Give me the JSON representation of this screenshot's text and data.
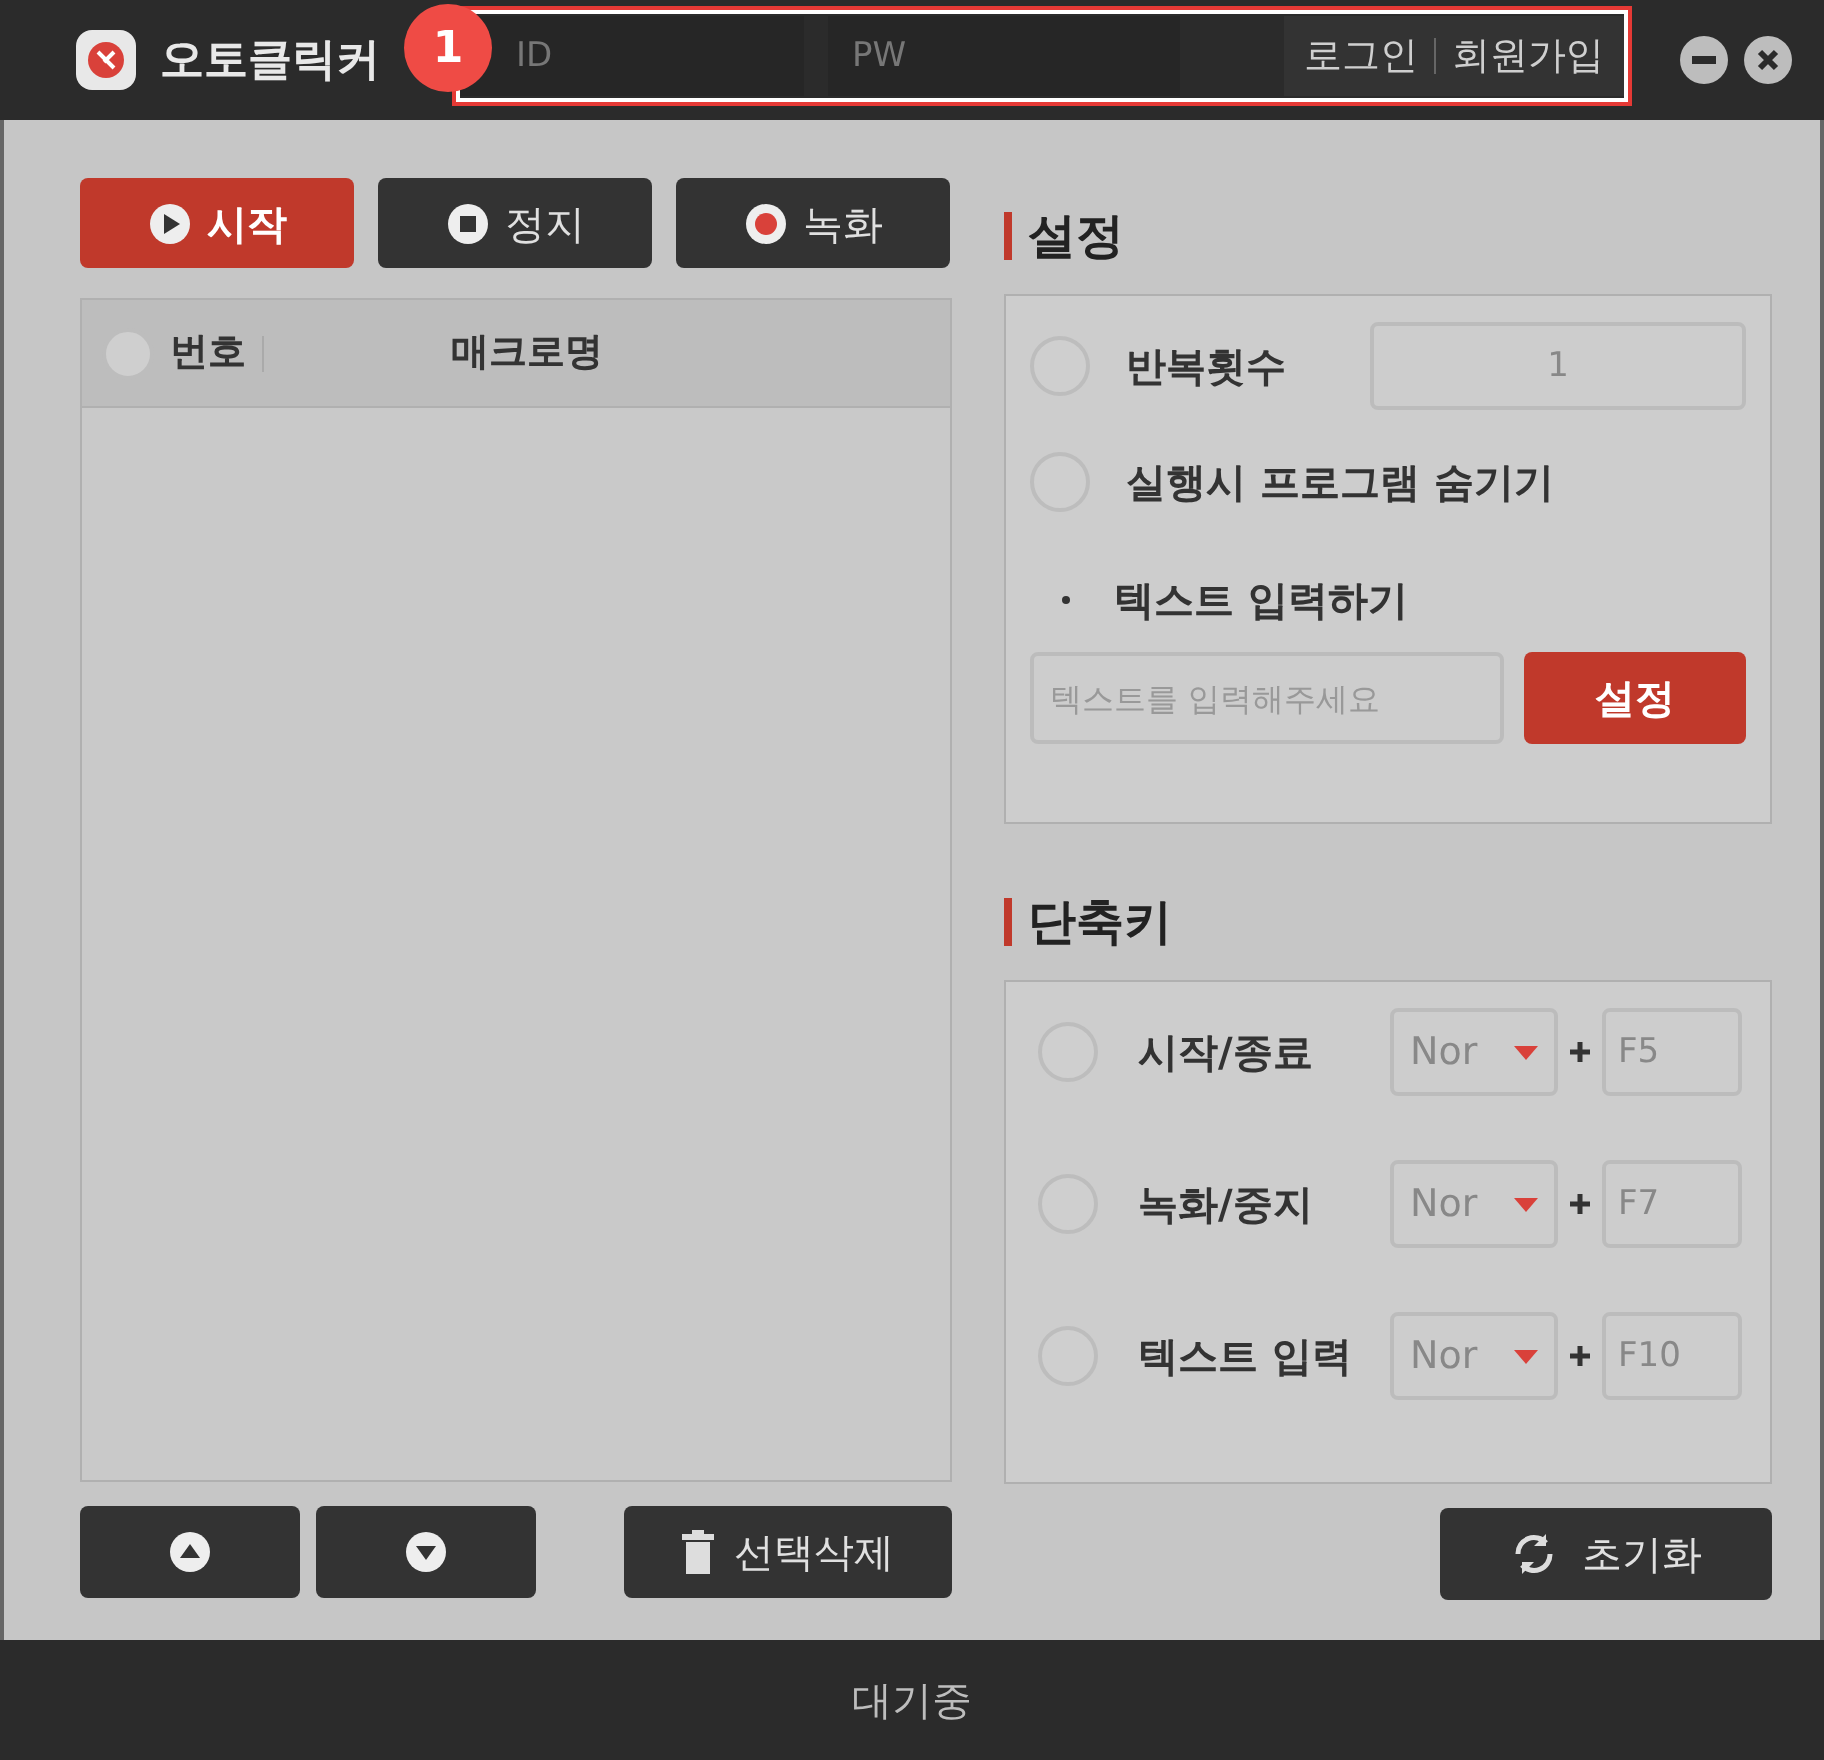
{
  "window": {
    "title": "오토클릭커"
  },
  "login": {
    "id_placeholder": "ID",
    "pw_placeholder": "PW",
    "login_button": "로그인",
    "signup_button": "회원가입",
    "annotation": "1"
  },
  "controls": [
    {
      "label": "시작",
      "kind": "play",
      "selected": true
    },
    {
      "label": "정지",
      "kind": "stop",
      "selected": false
    },
    {
      "label": "녹화",
      "kind": "record",
      "selected": false
    }
  ],
  "table": {
    "select_all_checked": false,
    "columns": [
      "번호",
      "매크로명"
    ]
  },
  "settings": {
    "title": "설정",
    "options": [
      {
        "label": "반복횟수",
        "checked": false,
        "value": "1"
      },
      {
        "label": "실행시 프로그램 숨기기",
        "checked": false
      }
    ],
    "text_input": {
      "label": "텍스트 입력하기",
      "placeholder": "텍스트를 입력해주세요",
      "button": "설정"
    }
  },
  "hotkeys": {
    "title": "단축키",
    "rows": [
      {
        "label": "시작/종료",
        "checked": false,
        "modifier": "Nor",
        "key": "F5"
      },
      {
        "label": "녹화/중지",
        "checked": false,
        "modifier": "Nor",
        "key": "F7"
      },
      {
        "label": "텍스트 입력",
        "checked": false,
        "modifier": "Nor",
        "key": "F10"
      }
    ]
  },
  "list_buttons": {
    "delete": "선택삭제"
  },
  "reset_button": "초기화",
  "status_bar": "대기중"
}
